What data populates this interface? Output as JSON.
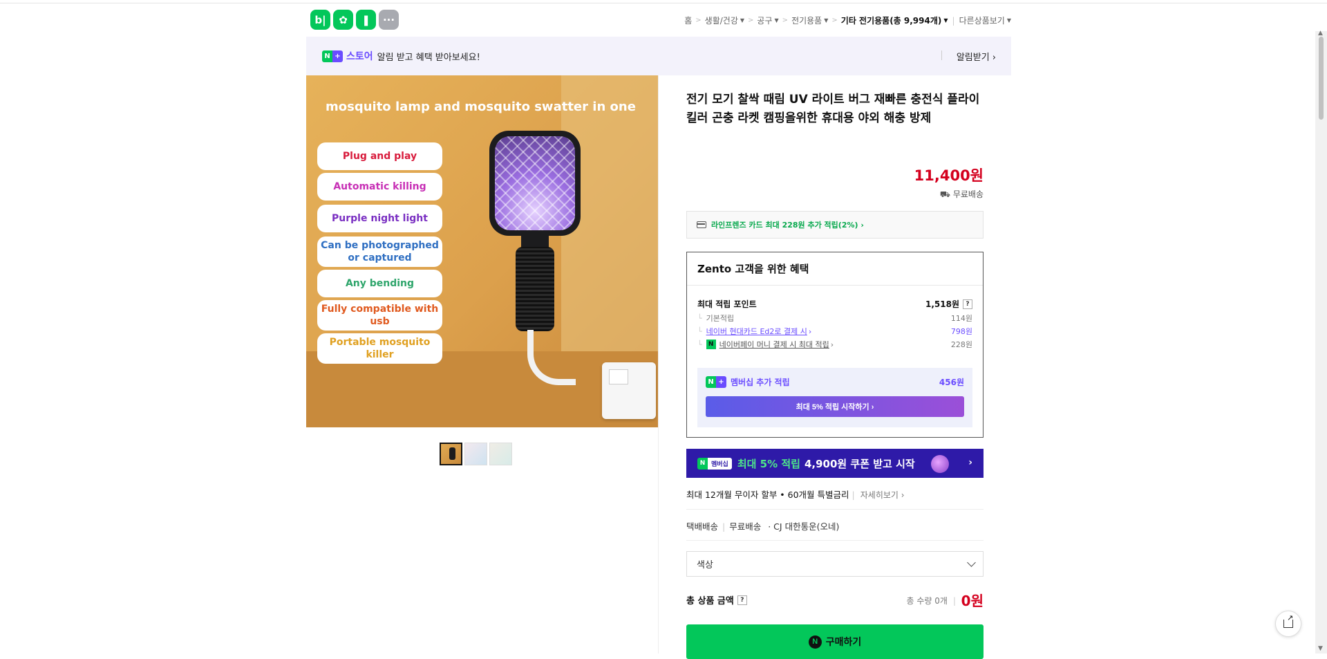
{
  "header": {
    "apps": [
      {
        "name": "blog-icon",
        "glyph": "b|"
      },
      {
        "name": "apple-icon",
        "glyph": "✿"
      },
      {
        "name": "bookmark-icon",
        "glyph": "❚"
      },
      {
        "name": "more-icon",
        "glyph": "···"
      }
    ],
    "breadcrumbs": [
      "홈",
      "생활/건강",
      "공구",
      "전기용품"
    ],
    "current_category": "기타 전기용품(총 9,994개)",
    "other_products": "다른상품보기"
  },
  "banner": {
    "badge_n": "N",
    "badge_plus": "+",
    "store": "스토어",
    "message": "알림 받고 혜택 받아보세요!",
    "alarm_label": "알림받기 ›"
  },
  "image": {
    "headline": "mosquito lamp and mosquito swatter in one",
    "features": [
      {
        "label": "Plug and play",
        "color": "#d81b3c"
      },
      {
        "label": "Automatic killing",
        "color": "#c72fb5"
      },
      {
        "label": "Purple night light",
        "color": "#7a2fc2"
      },
      {
        "label": "Can be photographed or captured",
        "color": "#2f6fc2"
      },
      {
        "label": "Any bending",
        "color": "#2ea56b"
      },
      {
        "label": "Fully compatible with usb",
        "color": "#e05a1f"
      },
      {
        "label": "Portable mosquito killer",
        "color": "#e0a020"
      }
    ]
  },
  "product": {
    "title": "전기 모기 찰싹 때림 UV 라이트 버그 재빠른 충전식 플라이 킬러 곤충 라켓 캠핑을위한 휴대용 야외 해충 방제",
    "price": "11,400원",
    "shipping": "무료배송",
    "card_offer": "라인프렌즈 카드 최대 228원 추가 적립(2%) ›"
  },
  "benefit": {
    "header": "Zento 고객을 위한 혜택",
    "max_points_label": "최대 적립 포인트",
    "max_points_value": "1,518원",
    "help": "?",
    "rows": [
      {
        "label": "기본적립",
        "value": "114원"
      },
      {
        "label": "네이버 현대카드 Ed2로 결제 시",
        "value": "798원"
      },
      {
        "label": "네이버페이 머니 결제 시 최대 적립",
        "value": "228원"
      }
    ],
    "npay_glyph": "N",
    "membership_label": "멤버십 추가 적립",
    "membership_value": "456원",
    "membership_button": "최대 5% 적립 시작하기 ›"
  },
  "promo": {
    "badge_n": "N",
    "badge_text": "멤버십",
    "highlight": "최대 5% 적립",
    "text": "4,900원 쿠폰 받고 시작",
    "arrow": "›"
  },
  "installment": {
    "text": "최대 12개월 무이자 할부 • 60개월 특별금리",
    "more": "자세히보기 ›"
  },
  "delivery": {
    "type": "택배배송",
    "fee": "무료배송",
    "courier": "· CJ 대한통운(오네)"
  },
  "option": {
    "placeholder": "색상"
  },
  "total": {
    "label": "총 상품 금액",
    "help": "?",
    "quantity": "총 수량 0개",
    "amount": "0원"
  },
  "buy": {
    "icon": "N",
    "label": "구매하기"
  },
  "colors": {
    "naver_green": "#03c75a",
    "accent_purple": "#6a4cff",
    "price_red": "#d4001e",
    "promo_navy": "#2e1aa8"
  }
}
